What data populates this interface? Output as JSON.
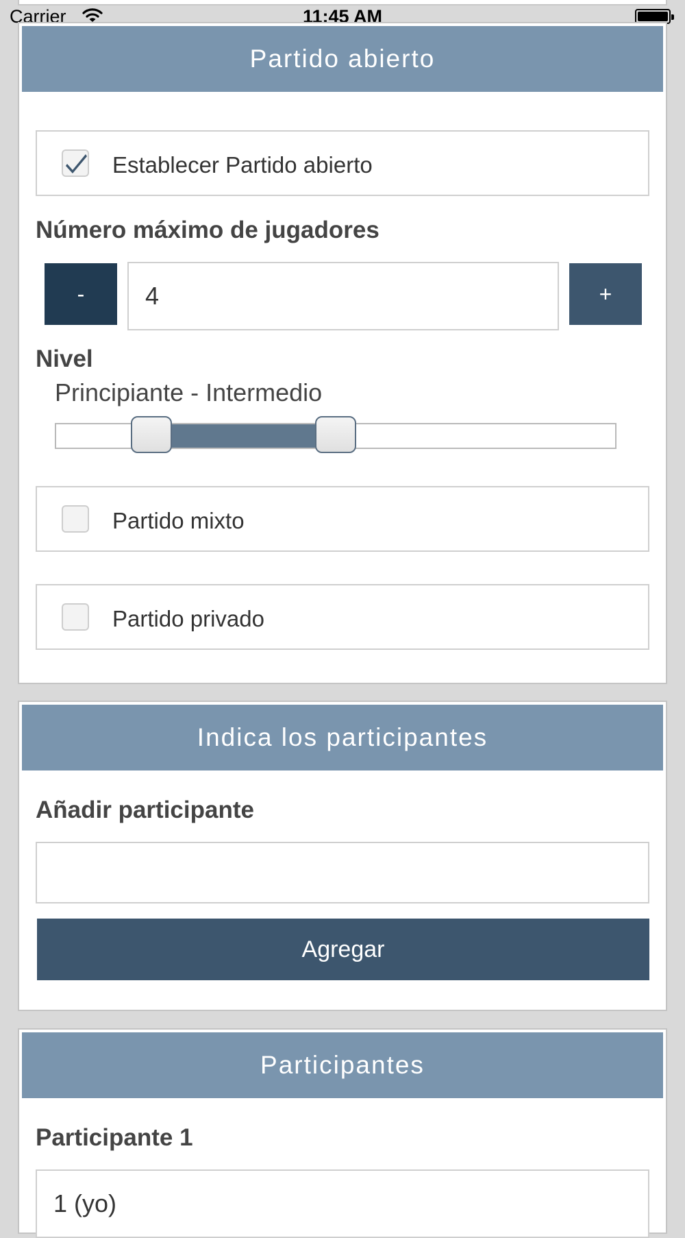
{
  "status_bar": {
    "carrier": "Carrier",
    "time": "11:45 AM"
  },
  "open_match": {
    "header": "Partido abierto",
    "open_checkbox": {
      "label": "Establecer Partido abierto",
      "checked": true
    },
    "max_players_label": "Número máximo de jugadores",
    "stepper": {
      "minus_label": "-",
      "value": "4",
      "plus_label": "+"
    },
    "level_label": "Nivel",
    "level_value": "Principiante - Intermedio",
    "level_range": {
      "low": 0.17,
      "high": 0.5
    },
    "mixed_checkbox": {
      "label": "Partido mixto",
      "checked": false
    },
    "private_checkbox": {
      "label": "Partido privado",
      "checked": false
    }
  },
  "participants_form": {
    "header": "Indica los participantes",
    "add_label": "Añadir participante",
    "add_input_value": "",
    "add_button": "Agregar"
  },
  "participants": {
    "header": "Participantes",
    "items": [
      {
        "label": "Participante 1",
        "value": "1 (yo)"
      }
    ]
  },
  "colors": {
    "header_bg": "#7a95ae",
    "button_dark": "#213b52",
    "button": "#3d566e",
    "slider_range": "#60788e",
    "check_color": "#3d566e"
  }
}
